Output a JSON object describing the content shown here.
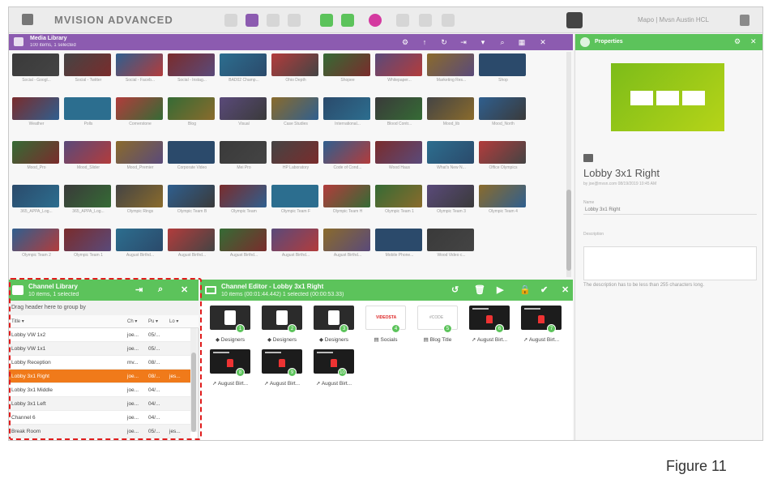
{
  "topbar": {
    "brand": "MVISION ADVANCED",
    "user": "Mapo | Mvsn Austin HCL"
  },
  "media_library": {
    "title": "Media Library",
    "subtitle": "100 items, 1 selected",
    "captions": [
      [
        "Social - Googl...",
        "Social - Twitter",
        "Social - Faceb...",
        "Social - Instag...",
        "BAD02 Champ...",
        "Ohio Depth",
        "Shopee",
        "Whitepaper...",
        "Marketing Res...",
        "Shop"
      ],
      [
        "Weather",
        "Polls",
        "Cornerstone",
        "Blog",
        "Visual",
        "Case Studies",
        "International...",
        "Blood Contr...",
        "Mood_lib",
        "Mood_North"
      ],
      [
        "Mood_Pro",
        "Mood_Slider",
        "Mood_Premier",
        "Corporate Video",
        "Mei Pro",
        "HP Laboratory",
        "Code of Cond...",
        "Wood Haus",
        "What's New N...",
        "Office Olympics"
      ],
      [
        "365_APPA_Log...",
        "365_APPA_Log...",
        "Olympic Rings",
        "Olympic Team B",
        "Olympic Team",
        "Olympic Team F",
        "Olympic Team H",
        "Olympic Team 1",
        "Olympic Team 3",
        "Olympic Team 4"
      ],
      [
        "Olympic Team 2",
        "Olympic Team 1",
        "August Birthd...",
        "August Birthd...",
        "August Birthd...",
        "August Birthd...",
        "August Birthd...",
        "Mobile Phone...",
        "Wood Video c..."
      ]
    ]
  },
  "properties": {
    "title": "Properties",
    "name": "Lobby 3x1 Right",
    "sub": "by joe@mvsn.com 08/19/2019 10:45 AM",
    "name_label": "Name",
    "name_value": "Lobby 3x1 Right",
    "desc_label": "Description",
    "hint": "The description has to be less than 255 characters long."
  },
  "channel_library": {
    "title": "Channel Library",
    "subtitle": "10 items, 1 selected",
    "group_hint": "Drag header here to group by",
    "columns": [
      "Title",
      "Ch",
      "Pu",
      "Lo"
    ],
    "rows": [
      [
        "Lobby VW 1x2",
        "joe...",
        "05/...",
        ""
      ],
      [
        "Lobby VW 1x1",
        "joe...",
        "05/...",
        ""
      ],
      [
        "Lobby Reception",
        "mv...",
        "08/...",
        ""
      ],
      [
        "Lobby 3x1 Right",
        "joe...",
        "08/...",
        "jes..."
      ],
      [
        "Lobby 3x1 Middle",
        "joe...",
        "04/...",
        ""
      ],
      [
        "Lobby 3x1 Left",
        "joe...",
        "04/...",
        ""
      ],
      [
        "Channel 6",
        "joe...",
        "04/...",
        ""
      ],
      [
        "Break Room",
        "joe...",
        "05/...",
        "jes..."
      ]
    ]
  },
  "channel_editor": {
    "title": "Channel Editor - Lobby 3x1 Right",
    "subtitle": "10 items (00:01:44.442) 1 selected (00:00:53.33)",
    "tiles": [
      {
        "n": "1",
        "label": "Designers",
        "kind": "dark"
      },
      {
        "n": "2",
        "label": "Designers",
        "kind": "dark"
      },
      {
        "n": "3",
        "label": "Designers",
        "kind": "dark"
      },
      {
        "n": "4",
        "label": "Socials",
        "kind": "white",
        "logo": "VIDEOSTA"
      },
      {
        "n": "5",
        "label": "Blog Title",
        "kind": "white",
        "logo": "#CODE"
      },
      {
        "n": "6",
        "label": "August Birt...",
        "kind": "video"
      },
      {
        "n": "7",
        "label": "August Birt...",
        "kind": "video"
      },
      {
        "n": "8",
        "label": "August Birt...",
        "kind": "video"
      },
      {
        "n": "9",
        "label": "August Birt...",
        "kind": "video"
      },
      {
        "n": "10",
        "label": "August Birt...",
        "kind": "video"
      }
    ]
  },
  "figure_caption": "Figure 11",
  "colors": {
    "purple": "#8c5bb0",
    "green": "#5cc35b",
    "orange": "#f07a1a",
    "highlight": "#e01c1c"
  }
}
